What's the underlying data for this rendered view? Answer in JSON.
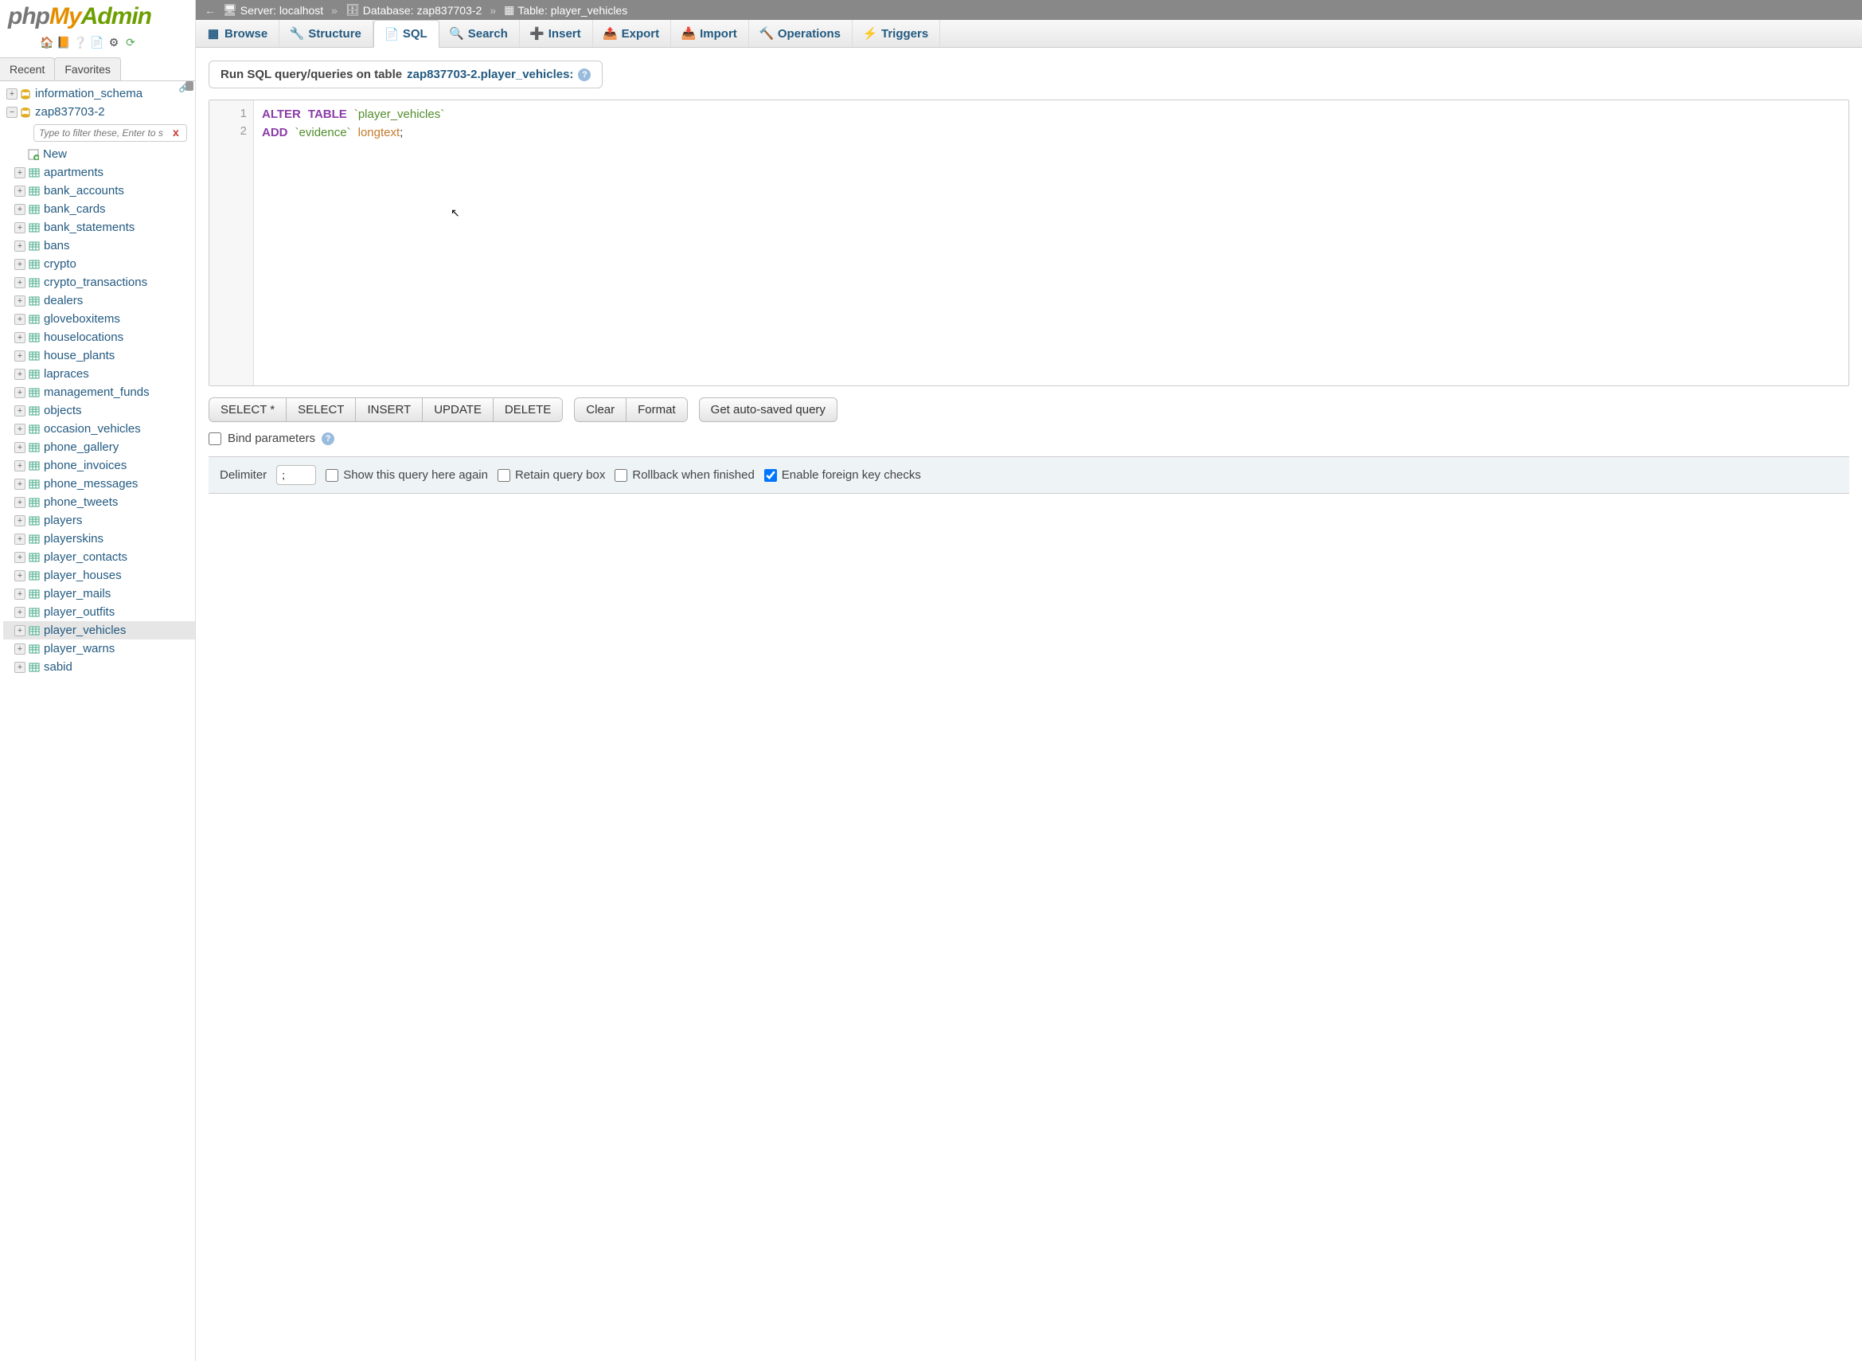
{
  "logo": {
    "php": "php",
    "my": "My",
    "admin": "Admin"
  },
  "side_tabs": {
    "recent": "Recent",
    "favorites": "Favorites"
  },
  "filter": {
    "placeholder": "Type to filter these, Enter to s",
    "clear": "x"
  },
  "tree": {
    "dbs": [
      {
        "name": "information_schema"
      },
      {
        "name": "zap837703-2",
        "expanded": true
      }
    ],
    "new_label": "New",
    "tables": [
      "apartments",
      "bank_accounts",
      "bank_cards",
      "bank_statements",
      "bans",
      "crypto",
      "crypto_transactions",
      "dealers",
      "gloveboxitems",
      "houselocations",
      "house_plants",
      "lapraces",
      "management_funds",
      "objects",
      "occasion_vehicles",
      "phone_gallery",
      "phone_invoices",
      "phone_messages",
      "phone_tweets",
      "players",
      "playerskins",
      "player_contacts",
      "player_houses",
      "player_mails",
      "player_outfits",
      "player_vehicles",
      "player_warns",
      "sabid"
    ],
    "selected": "player_vehicles"
  },
  "breadcrumb": {
    "server_label": "Server:",
    "server": "localhost",
    "db_label": "Database:",
    "db": "zap837703-2",
    "table_label": "Table:",
    "table": "player_vehicles",
    "sep": "»"
  },
  "tabs": {
    "items": [
      "Browse",
      "Structure",
      "SQL",
      "Search",
      "Insert",
      "Export",
      "Import",
      "Operations",
      "Triggers"
    ],
    "active": "SQL"
  },
  "heading": {
    "prefix": "Run SQL query/queries on table ",
    "target": "zap837703-2.player_vehicles:",
    "help": "?"
  },
  "sql": {
    "line1": {
      "kw1": "ALTER",
      "kw2": "TABLE",
      "bt": "`",
      "id": "player_vehicles"
    },
    "line2": {
      "kw": "ADD",
      "bt": "`",
      "id": "evidence",
      "ty": "longtext",
      "sc": ";"
    },
    "gutter": [
      "1",
      "2"
    ]
  },
  "buttons": {
    "select_all": "SELECT *",
    "select": "SELECT",
    "insert": "INSERT",
    "update": "UPDATE",
    "delete": "DELETE",
    "clear": "Clear",
    "format": "Format",
    "autosaved": "Get auto-saved query"
  },
  "bind": {
    "label": "Bind parameters"
  },
  "footer": {
    "delimiter_label": "Delimiter",
    "delimiter_value": ";",
    "show_again": "Show this query here again",
    "retain": "Retain query box",
    "rollback": "Rollback when finished",
    "fk": "Enable foreign key checks"
  }
}
